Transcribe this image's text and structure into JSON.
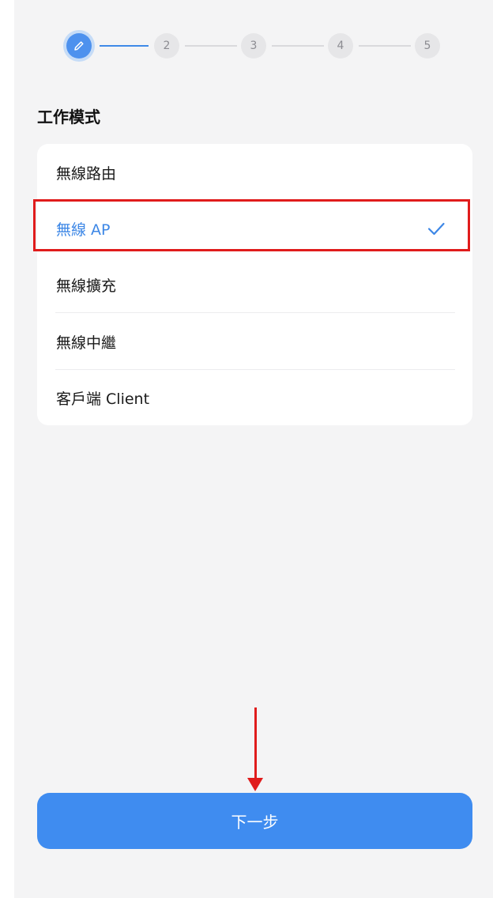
{
  "stepper": {
    "active_icon": "pencil-icon",
    "steps": [
      "2",
      "3",
      "4",
      "5"
    ]
  },
  "section_title": "工作模式",
  "options": [
    {
      "label": "無線路由",
      "selected": false
    },
    {
      "label": "無線 AP",
      "selected": true
    },
    {
      "label": "無線擴充",
      "selected": false
    },
    {
      "label": "無線中繼",
      "selected": false
    },
    {
      "label": "客戶端 Client",
      "selected": false
    }
  ],
  "next_button": "下一步",
  "colors": {
    "accent": "#3f8cf0",
    "annotation": "#e01c1c"
  }
}
